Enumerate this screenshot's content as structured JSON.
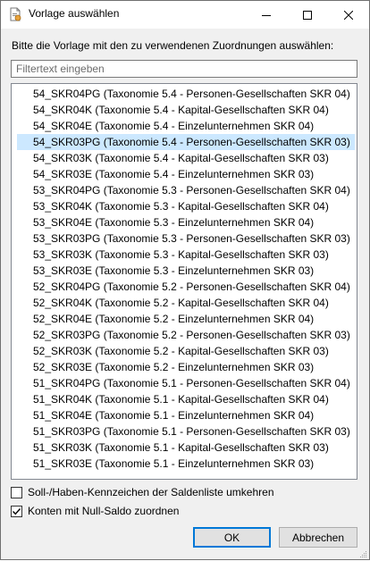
{
  "window": {
    "title": "Vorlage auswählen",
    "icon": "app-document-icon"
  },
  "titlebar_buttons": {
    "minimize": "minimize-icon",
    "maximize": "maximize-icon",
    "close": "close-icon"
  },
  "instruction": "Bitte die Vorlage mit den zu verwendenen Zuordnungen auswählen:",
  "filter": {
    "placeholder": "Filtertext eingeben",
    "value": ""
  },
  "templates": {
    "selected_index": 3,
    "items": [
      "54_SKR04PG (Taxonomie 5.4 - Personen-Gesellschaften SKR 04)",
      "54_SKR04K (Taxonomie 5.4 - Kapital-Gesellschaften SKR 04)",
      "54_SKR04E (Taxonomie 5.4 - Einzelunternehmen SKR 04)",
      "54_SKR03PG (Taxonomie 5.4 - Personen-Gesellschaften SKR 03)",
      "54_SKR03K (Taxonomie 5.4 - Kapital-Gesellschaften SKR 03)",
      "54_SKR03E (Taxonomie 5.4 - Einzelunternehmen SKR 03)",
      "53_SKR04PG (Taxonomie 5.3 - Personen-Gesellschaften SKR 04)",
      "53_SKR04K (Taxonomie 5.3 - Kapital-Gesellschaften SKR 04)",
      "53_SKR04E (Taxonomie 5.3 - Einzelunternehmen SKR 04)",
      "53_SKR03PG (Taxonomie 5.3 - Personen-Gesellschaften SKR 03)",
      "53_SKR03K (Taxonomie 5.3 - Kapital-Gesellschaften SKR 03)",
      "53_SKR03E (Taxonomie 5.3 - Einzelunternehmen SKR 03)",
      "52_SKR04PG (Taxonomie 5.2 - Personen-Gesellschaften SKR 04)",
      "52_SKR04K (Taxonomie 5.2 - Kapital-Gesellschaften SKR 04)",
      "52_SKR04E (Taxonomie 5.2 - Einzelunternehmen SKR 04)",
      "52_SKR03PG (Taxonomie 5.2 - Personen-Gesellschaften SKR 03)",
      "52_SKR03K (Taxonomie 5.2 - Kapital-Gesellschaften SKR 03)",
      "52_SKR03E (Taxonomie 5.2 - Einzelunternehmen SKR 03)",
      "51_SKR04PG (Taxonomie 5.1 - Personen-Gesellschaften SKR 04)",
      "51_SKR04K (Taxonomie 5.1 - Kapital-Gesellschaften SKR 04)",
      "51_SKR04E (Taxonomie 5.1 - Einzelunternehmen SKR 04)",
      "51_SKR03PG (Taxonomie 5.1 - Personen-Gesellschaften SKR 03)",
      "51_SKR03K (Taxonomie 5.1 - Kapital-Gesellschaften SKR 03)",
      "51_SKR03E (Taxonomie 5.1 - Einzelunternehmen SKR 03)"
    ]
  },
  "options": {
    "flip_sign": {
      "label": "Soll-/Haben-Kennzeichen der Saldenliste umkehren",
      "checked": false
    },
    "zero_balance": {
      "label": "Konten mit Null-Saldo zuordnen",
      "checked": true
    }
  },
  "buttons": {
    "ok": "OK",
    "cancel": "Abbrechen"
  },
  "colors": {
    "selection": "#cce8ff",
    "default_button_border": "#0078d7",
    "dialog_background": "#f0f0f0"
  }
}
